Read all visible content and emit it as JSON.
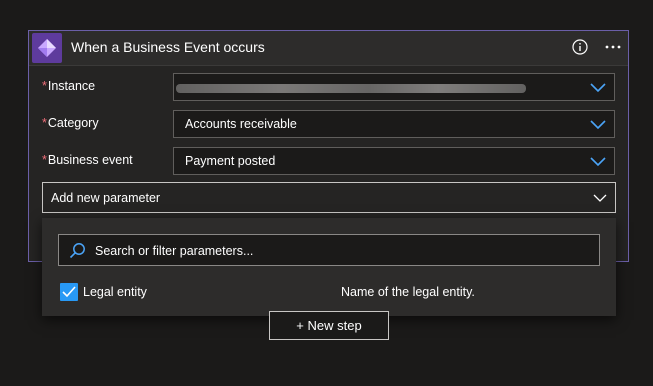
{
  "trigger": {
    "title": "When a Business Event occurs",
    "icon": "dynamics-finance-icon",
    "accent": "#5e3b9d"
  },
  "fields": {
    "required_marker": "*",
    "instance": {
      "label": "Instance",
      "value": ""
    },
    "category": {
      "label": "Category",
      "value": "Accounts receivable"
    },
    "business_event": {
      "label": "Business event",
      "value": "Payment posted"
    }
  },
  "add_parameter": {
    "label": "Add new parameter"
  },
  "parameter_panel": {
    "search_placeholder": "Search or filter parameters...",
    "items": [
      {
        "name": "Legal entity",
        "description": "Name of the legal entity.",
        "checked": true
      }
    ]
  },
  "new_step": {
    "label": "+ New step"
  },
  "colors": {
    "background": "#1b1a19",
    "card_border": "#6b5fa8",
    "checkbox": "#2899f5",
    "chevron": "#4ba4f7",
    "required": "#f1707b"
  }
}
